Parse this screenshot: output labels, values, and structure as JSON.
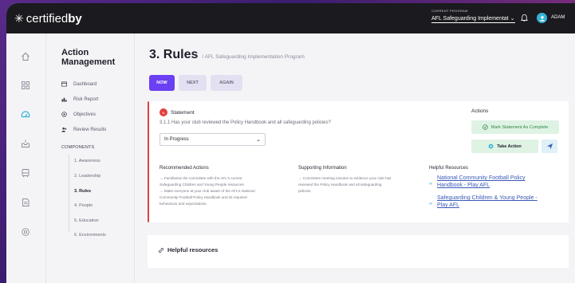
{
  "brand": {
    "part1": "certified",
    "part2": "by"
  },
  "program": {
    "label": "CURRENT PROGRAM",
    "value": "AFL Safeguarding Implementat"
  },
  "user": {
    "name": "ADAM"
  },
  "menu": {
    "title": "Action Management",
    "items": [
      {
        "label": "Dashboard",
        "icon": "dashboard-icon"
      },
      {
        "label": "Risk Report",
        "icon": "chart-icon"
      },
      {
        "label": "Objectives",
        "icon": "target-icon"
      },
      {
        "label": "Review Results",
        "icon": "users-icon"
      }
    ],
    "components_label": "COMPONENTS",
    "components": [
      "1. Awareness",
      "2. Leadership",
      "3. Rules",
      "4. People",
      "5. Education",
      "6. Environments"
    ]
  },
  "page": {
    "title": "3. Rules",
    "subtitle": "/ AFL Safeguarding Implementation Program"
  },
  "tabs": [
    "NOW",
    "NEXT",
    "AGAIN"
  ],
  "statement": {
    "badge": "N",
    "heading": "Statement",
    "question": "3.1.1 Has your club reviewed the Policy Handbook and all safeguarding policies?",
    "status": "In Progress"
  },
  "actions": {
    "label": "Actions",
    "complete": "Mark Statement As Complete",
    "take": "Take Action"
  },
  "recommended": {
    "heading": "Recommended Actions",
    "lines": [
      "→ Familiarise the committee with the AFL's current",
      "Safeguarding Children and Young People resources.",
      "→ Make everyone at your club aware of the AFL's National",
      "Community Football Policy Handbook and its required",
      "behaviours and expectations."
    ]
  },
  "supporting": {
    "heading": "Supporting Information",
    "lines": [
      "→ Committee meeting minutes to evidence your club has",
      "reviewed the Policy Handbook and all safeguarding",
      "policies."
    ]
  },
  "helpful": {
    "heading": "Helpful Resources",
    "links": [
      {
        "l1": "National Community Football Policy",
        "l2": "Handbook - Play AFL"
      },
      {
        "l1": "Safeguarding Children & Young People -",
        "l2": "Play AFL"
      }
    ]
  },
  "resources_card": {
    "heading": "Helpful resources"
  },
  "colors": {
    "accent": "#6b3ff2",
    "alert": "#e0413e",
    "success_bg": "#dff3e4",
    "link": "#3a5ab8",
    "topbar": "#1a1a1f"
  }
}
